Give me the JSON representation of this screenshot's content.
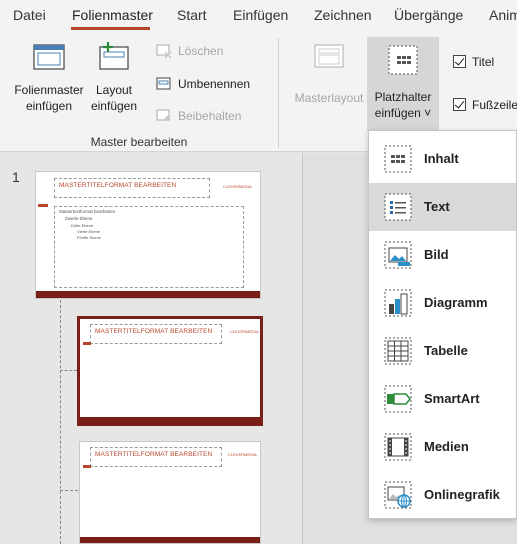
{
  "tabs": [
    "Datei",
    "Folienmaster",
    "Start",
    "Einfügen",
    "Zeichnen",
    "Übergänge",
    "Anim"
  ],
  "ribbon": {
    "folienmaster_line1": "Folienmaster",
    "folienmaster_line2": "einfügen",
    "layout_line1": "Layout",
    "layout_line2": "einfügen",
    "loeschen": "Löschen",
    "umbenennen": "Umbenennen",
    "beibehalten": "Beibehalten",
    "group_caption": "Master bearbeiten",
    "masterlayout": "Masterlayout",
    "platzhalter_line1": "Platzhalter",
    "platzhalter_line2": "einfügen ˅",
    "titel": "Titel",
    "fusszeilen": "Fußzeilen"
  },
  "slide_number": "1",
  "slide": {
    "title_placeholder": "MASTERTITELFORMAT BEARBEITEN",
    "body_level1": "Mastertextformat bearbeiten",
    "body_level2": "Zweite Ebene",
    "body_level3": "Dritte Ebene",
    "body_level4": "Vierte Ebene",
    "body_level5": "Fünfte Ebene",
    "logo_text": "CLEVERMEDIA"
  },
  "dropdown": {
    "items": [
      {
        "label": "Inhalt",
        "icon": "content-placeholder-icon"
      },
      {
        "label": "Text",
        "icon": "text-placeholder-icon"
      },
      {
        "label": "Bild",
        "icon": "picture-placeholder-icon"
      },
      {
        "label": "Diagramm",
        "icon": "chart-placeholder-icon"
      },
      {
        "label": "Tabelle",
        "icon": "table-placeholder-icon"
      },
      {
        "label": "SmartArt",
        "icon": "smartart-placeholder-icon"
      },
      {
        "label": "Medien",
        "icon": "media-placeholder-icon"
      },
      {
        "label": "Onlinegrafik",
        "icon": "online-picture-placeholder-icon"
      }
    ],
    "selected_index": 1
  },
  "colors": {
    "accent": "#b7472a",
    "footer": "#7a1f17",
    "selected_slide_border": "#7a1f17"
  }
}
